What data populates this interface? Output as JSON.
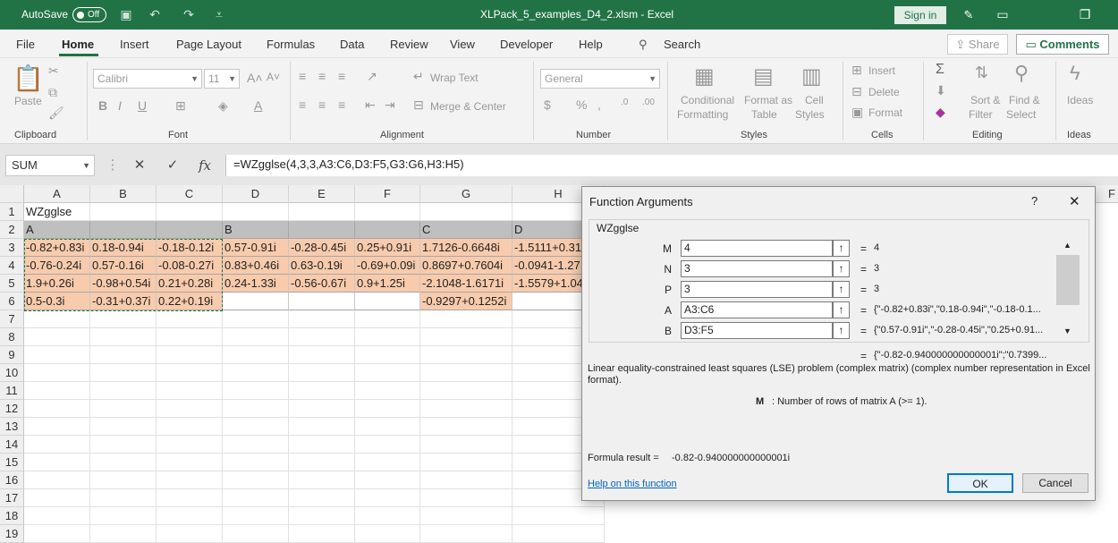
{
  "titlebar": {
    "autosave_label": "AutoSave",
    "autosave_state": "Off",
    "doc_title": "XLPack_5_examples_D4_2.xlsm  -  Excel",
    "signin": "Sign in"
  },
  "menu": {
    "items": [
      "File",
      "Home",
      "Insert",
      "Page Layout",
      "Formulas",
      "Data",
      "Review",
      "View",
      "Developer",
      "Help"
    ],
    "search": "Search",
    "share": "Share",
    "comments": "Comments"
  },
  "ribbon": {
    "clipboard": {
      "label": "Clipboard",
      "paste": "Paste"
    },
    "font": {
      "label": "Font",
      "name": "Calibri",
      "size": "11"
    },
    "alignment": {
      "label": "Alignment",
      "wrap": "Wrap Text",
      "merge": "Merge & Center"
    },
    "number": {
      "label": "Number",
      "format": "General"
    },
    "styles": {
      "label": "Styles",
      "conditional_1": "Conditional",
      "conditional_2": "Formatting",
      "format_table_1": "Format as",
      "format_table_2": "Table",
      "cell_styles_1": "Cell",
      "cell_styles_2": "Styles"
    },
    "cells": {
      "label": "Cells",
      "insert": "Insert",
      "delete": "Delete",
      "format": "Format"
    },
    "editing": {
      "label": "Editing",
      "sort_1": "Sort &",
      "sort_2": "Filter",
      "find_1": "Find &",
      "find_2": "Select"
    },
    "ideas": {
      "label": "Ideas",
      "btn": "Ideas"
    }
  },
  "formula_bar": {
    "name_box": "SUM",
    "formula": "=WZgglse(4,3,3,A3:C6,D3:F5,G3:G6,H3:H5)"
  },
  "grid": {
    "columns": [
      "A",
      "B",
      "C",
      "D",
      "E",
      "F",
      "G",
      "H"
    ],
    "rows": [
      "1",
      "2",
      "3",
      "4",
      "5",
      "6",
      "7",
      "8",
      "9",
      "10",
      "11",
      "12",
      "13",
      "14",
      "15",
      "16",
      "17",
      "18",
      "19"
    ],
    "r1": [
      "WZgglse"
    ],
    "r2": [
      "A",
      "",
      "",
      "B",
      "",
      "",
      "C",
      "D"
    ],
    "r3": [
      "-0.82+0.83i",
      "0.18-0.94i",
      "-0.18-0.12i",
      "0.57-0.91i",
      "-0.28-0.45i",
      "0.25+0.91i",
      "1.7126-0.6648i",
      "-1.5111+0.31"
    ],
    "r4": [
      "-0.76-0.24i",
      "0.57-0.16i",
      "-0.08-0.27i",
      "0.83+0.46i",
      "0.63-0.19i",
      "-0.69+0.09i",
      "0.8697+0.7604i",
      "-0.0941-1.27"
    ],
    "r5": [
      "1.9+0.26i",
      "-0.98+0.54i",
      "0.21+0.28i",
      "0.24-1.33i",
      "-0.56-0.67i",
      "0.9+1.25i",
      "-2.1048-1.6171i",
      "-1.5579+1.04"
    ],
    "r6": [
      "0.5-0.3i",
      "-0.31+0.37i",
      "0.22+0.19i",
      "",
      "",
      "",
      "-0.9297+0.1252i",
      ""
    ],
    "partial_col_label": "F",
    "colors": {
      "header_fill": "#bfbfbf",
      "data_fill": "#f8cbad"
    }
  },
  "dialog": {
    "title": "Function Arguments",
    "help_glyph": "?",
    "close_glyph": "✕",
    "function_name": "WZgglse",
    "args": [
      {
        "name": "M",
        "input": "4",
        "value": "4"
      },
      {
        "name": "N",
        "input": "3",
        "value": "3"
      },
      {
        "name": "P",
        "input": "3",
        "value": "3"
      },
      {
        "name": "A",
        "input": "A3:C6",
        "value": "{\"-0.82+0.83i\",\"0.18-0.94i\",\"-0.18-0.1..."
      },
      {
        "name": "B",
        "input": "D3:F5",
        "value": "{\"0.57-0.91i\",\"-0.28-0.45i\",\"0.25+0.91..."
      }
    ],
    "eq": "=",
    "result_preview": "{\"-0.82-0.940000000000001i\";\"0.7399...",
    "description": "Linear equality-constrained least squares (LSE) problem (complex matrix) (complex number representation in Excel format).",
    "arg_help_name": "M",
    "arg_help_text": ": Number of rows of matrix A (>= 1).",
    "formula_result_label": "Formula result =",
    "formula_result_value": "-0.82-0.940000000000001i",
    "help_link": "Help on this function",
    "ok": "OK",
    "cancel": "Cancel"
  }
}
